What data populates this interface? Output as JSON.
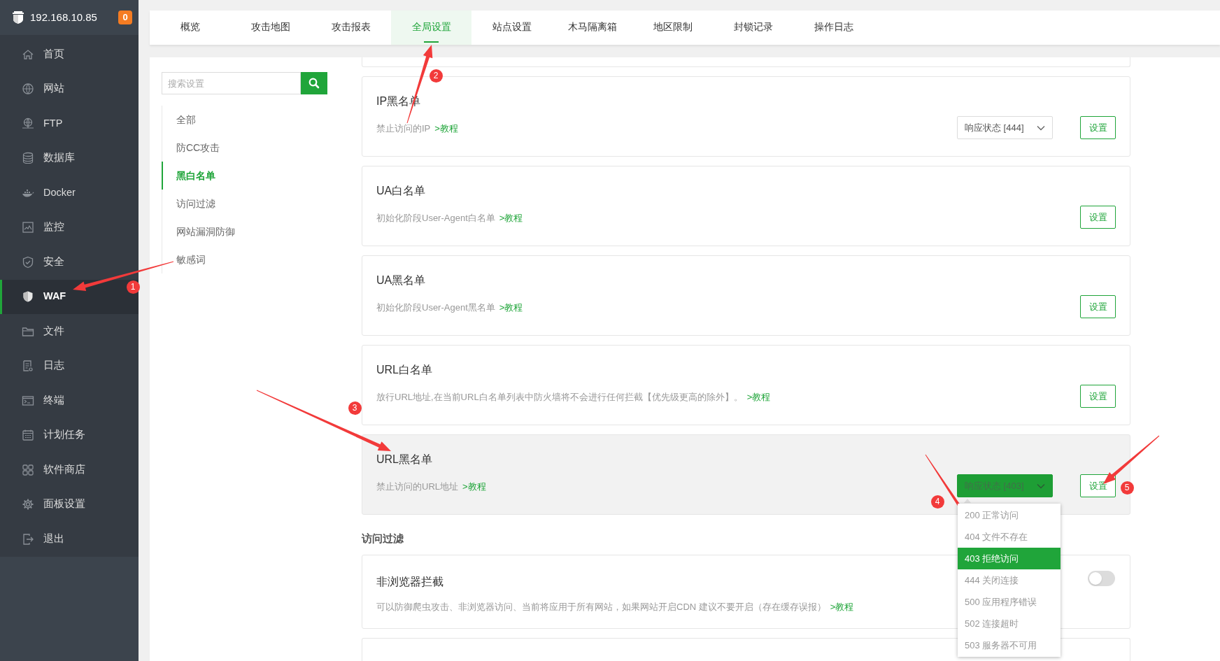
{
  "sidebar": {
    "host": "192.168.10.85",
    "badge": "0",
    "items": [
      {
        "label": "首页",
        "selected": false
      },
      {
        "label": "网站",
        "selected": false
      },
      {
        "label": "FTP",
        "selected": false
      },
      {
        "label": "数据库",
        "selected": false
      },
      {
        "label": "Docker",
        "selected": false
      },
      {
        "label": "监控",
        "selected": false
      },
      {
        "label": "安全",
        "selected": false
      },
      {
        "label": "WAF",
        "selected": true
      },
      {
        "label": "文件",
        "selected": false
      },
      {
        "label": "日志",
        "selected": false
      },
      {
        "label": "终端",
        "selected": false
      },
      {
        "label": "计划任务",
        "selected": false
      },
      {
        "label": "软件商店",
        "selected": false
      },
      {
        "label": "面板设置",
        "selected": false
      },
      {
        "label": "退出",
        "selected": false
      }
    ]
  },
  "tabs": [
    {
      "label": "概览",
      "selected": false
    },
    {
      "label": "攻击地图",
      "selected": false
    },
    {
      "label": "攻击报表",
      "selected": false
    },
    {
      "label": "全局设置",
      "selected": true
    },
    {
      "label": "站点设置",
      "selected": false
    },
    {
      "label": "木马隔离箱",
      "selected": false
    },
    {
      "label": "地区限制",
      "selected": false
    },
    {
      "label": "封锁记录",
      "selected": false
    },
    {
      "label": "操作日志",
      "selected": false
    }
  ],
  "settings_search": {
    "placeholder": "搜索设置"
  },
  "settings_nav": [
    {
      "label": "全部",
      "selected": false
    },
    {
      "label": "防CC攻击",
      "selected": false
    },
    {
      "label": "黑白名单",
      "selected": true
    },
    {
      "label": "访问过滤",
      "selected": false
    },
    {
      "label": "网站漏洞防御",
      "selected": false
    },
    {
      "label": "敏感词",
      "selected": false
    }
  ],
  "sections": [
    {
      "cards": [
        {
          "kind": "select",
          "title": "IP黑名单",
          "description": "禁止访问的IP",
          "link": ">教程",
          "highlighted": false,
          "select": {
            "label": "响应状态 [444]",
            "open": false
          },
          "button": "设置"
        },
        {
          "kind": "button",
          "title": "UA白名单",
          "description": "初始化阶段User-Agent白名单",
          "link": ">教程",
          "highlighted": false,
          "button": "设置"
        },
        {
          "kind": "button",
          "title": "UA黑名单",
          "description": "初始化阶段User-Agent黑名单",
          "link": ">教程",
          "highlighted": false,
          "button": "设置"
        },
        {
          "kind": "button",
          "title": "URL白名单",
          "description": "放行URL地址,在当前URL白名单列表中防火墙将不会进行任何拦截【优先级更高的除外】。",
          "link": ">教程",
          "highlighted": false,
          "button": "设置"
        },
        {
          "kind": "select",
          "title": "URL黑名单",
          "description": "禁止访问的URL地址",
          "link": ">教程",
          "highlighted": true,
          "select": {
            "label": "响应状态 [403]",
            "open": true,
            "options": [
              {
                "label": "200 正常访问",
                "selected": false
              },
              {
                "label": "404 文件不存在",
                "selected": false
              },
              {
                "label": "403 拒绝访问",
                "selected": true
              },
              {
                "label": "444 关闭连接",
                "selected": false
              },
              {
                "label": "500 应用程序错误",
                "selected": false
              },
              {
                "label": "502 连接超时",
                "selected": false
              },
              {
                "label": "503 服务器不可用",
                "selected": false
              }
            ]
          },
          "button": "设置"
        }
      ]
    },
    {
      "title": "访问过滤",
      "cards": [
        {
          "kind": "toggle",
          "title": "非浏览器拦截",
          "description": "可以防御爬虫攻击、非浏览器访问、当前将应用于所有网站，如果网站开启CDN 建议不要开启（存在缓存误报）",
          "link": ">教程",
          "highlighted": false,
          "on": false
        }
      ]
    }
  ],
  "annotations": [
    "1",
    "2",
    "3",
    "4",
    "5"
  ]
}
